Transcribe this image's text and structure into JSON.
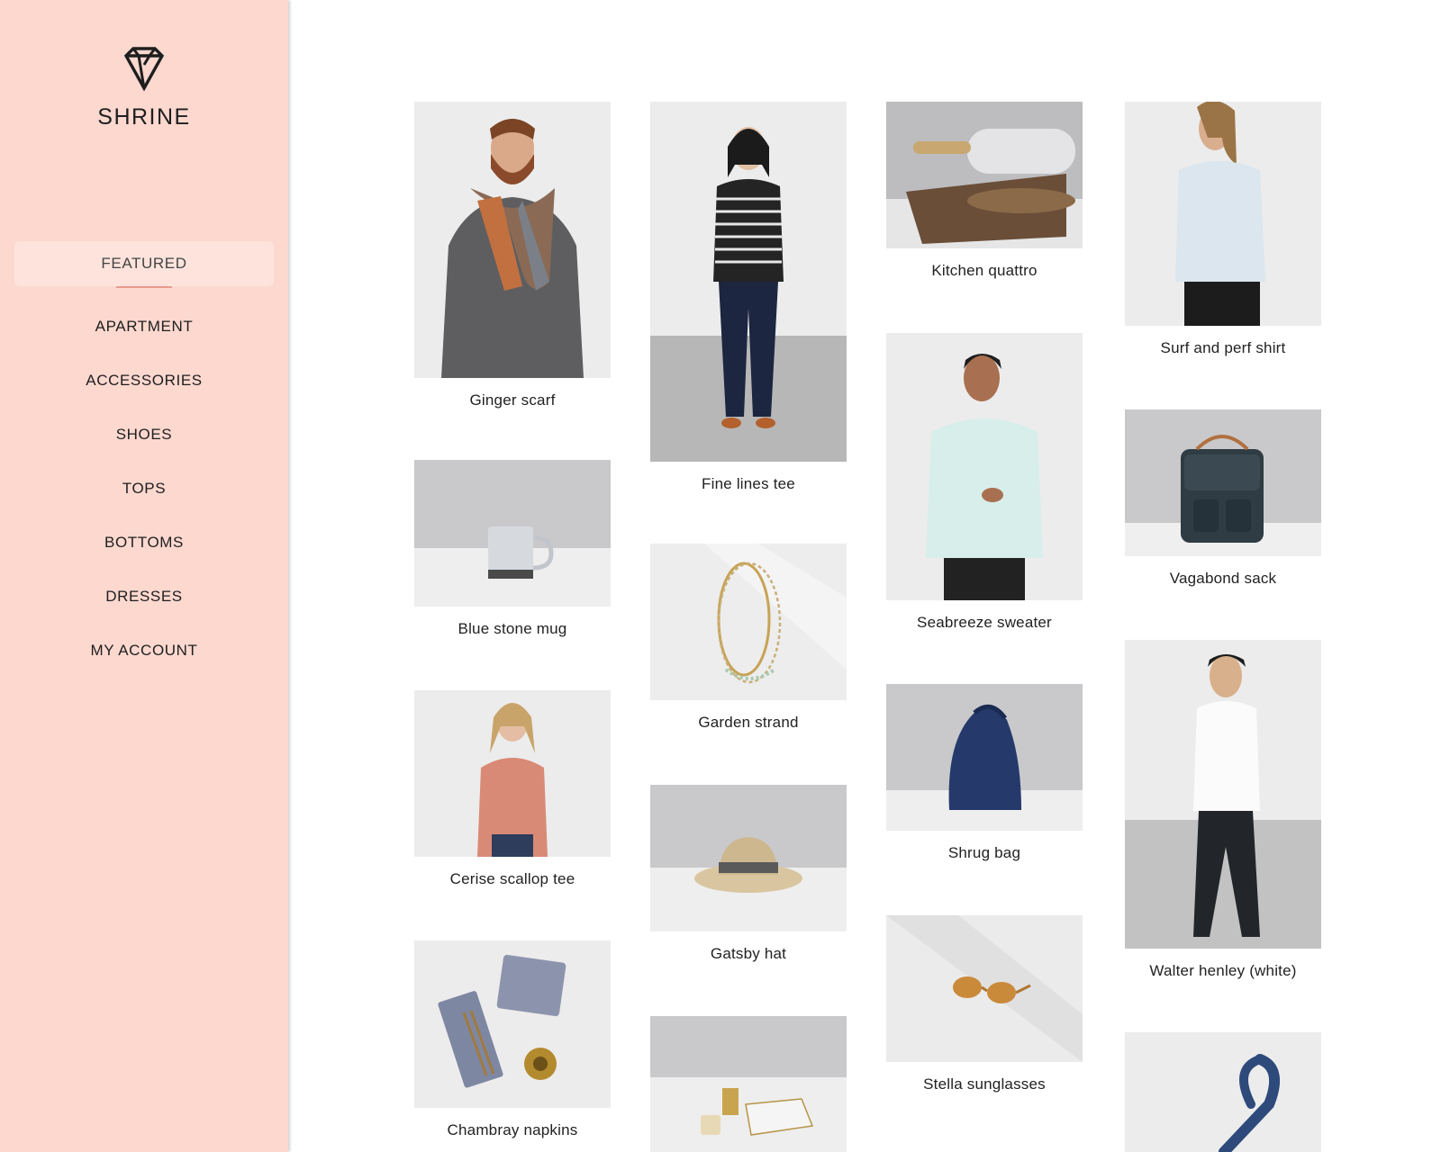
{
  "brand": {
    "name": "SHRINE",
    "logo": "diamond-icon"
  },
  "nav": [
    {
      "label": "FEATURED",
      "active": true
    },
    {
      "label": "APARTMENT"
    },
    {
      "label": "ACCESSORIES"
    },
    {
      "label": "SHOES"
    },
    {
      "label": "TOPS"
    },
    {
      "label": "BOTTOMS"
    },
    {
      "label": "DRESSES"
    },
    {
      "label": "MY ACCOUNT"
    }
  ],
  "products": [
    {
      "name": "Ginger scarf"
    },
    {
      "name": "Blue stone mug"
    },
    {
      "name": "Cerise scallop tee"
    },
    {
      "name": "Chambray napkins"
    },
    {
      "name": "Fine lines tee"
    },
    {
      "name": "Garden strand"
    },
    {
      "name": "Gatsby hat"
    },
    {
      "name": "Kitchen quattro"
    },
    {
      "name": "Seabreeze sweater"
    },
    {
      "name": "Shrug bag"
    },
    {
      "name": "Stella sunglasses"
    },
    {
      "name": "Surf and perf shirt"
    },
    {
      "name": "Vagabond sack"
    },
    {
      "name": "Walter henley (white)"
    }
  ],
  "colors": {
    "sidebar": "#fcd8cf",
    "active_nav": "#fde3dc",
    "accent": "#e89a90"
  }
}
